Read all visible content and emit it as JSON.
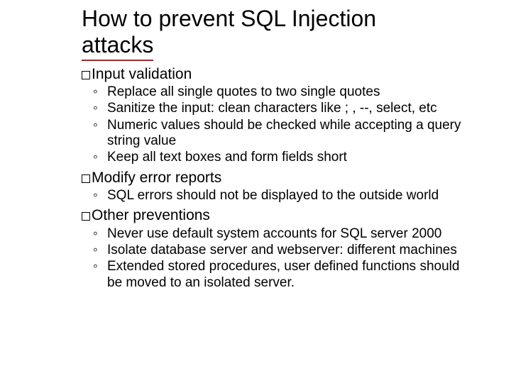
{
  "title_line1": "How to prevent SQL Injection",
  "title_line2": "attacks",
  "sections": {
    "s0": {
      "heading": "Input validation",
      "items": {
        "i0": "Replace all single quotes to two single quotes",
        "i1": "Sanitize the input: clean characters like ; , --, select, etc",
        "i2": "Numeric values should be checked while accepting a query string value",
        "i3": "Keep all text boxes and form fields short"
      }
    },
    "s1": {
      "heading": "Modify error reports",
      "items": {
        "i0": "SQL errors should not be displayed to the outside world"
      }
    },
    "s2": {
      "heading": "Other preventions",
      "items": {
        "i0": "Never use default system accounts for SQL server 2000",
        "i1": "Isolate database server and webserver: different machines",
        "i2": "Extended stored procedures, user defined functions should be moved to an isolated server."
      }
    }
  }
}
